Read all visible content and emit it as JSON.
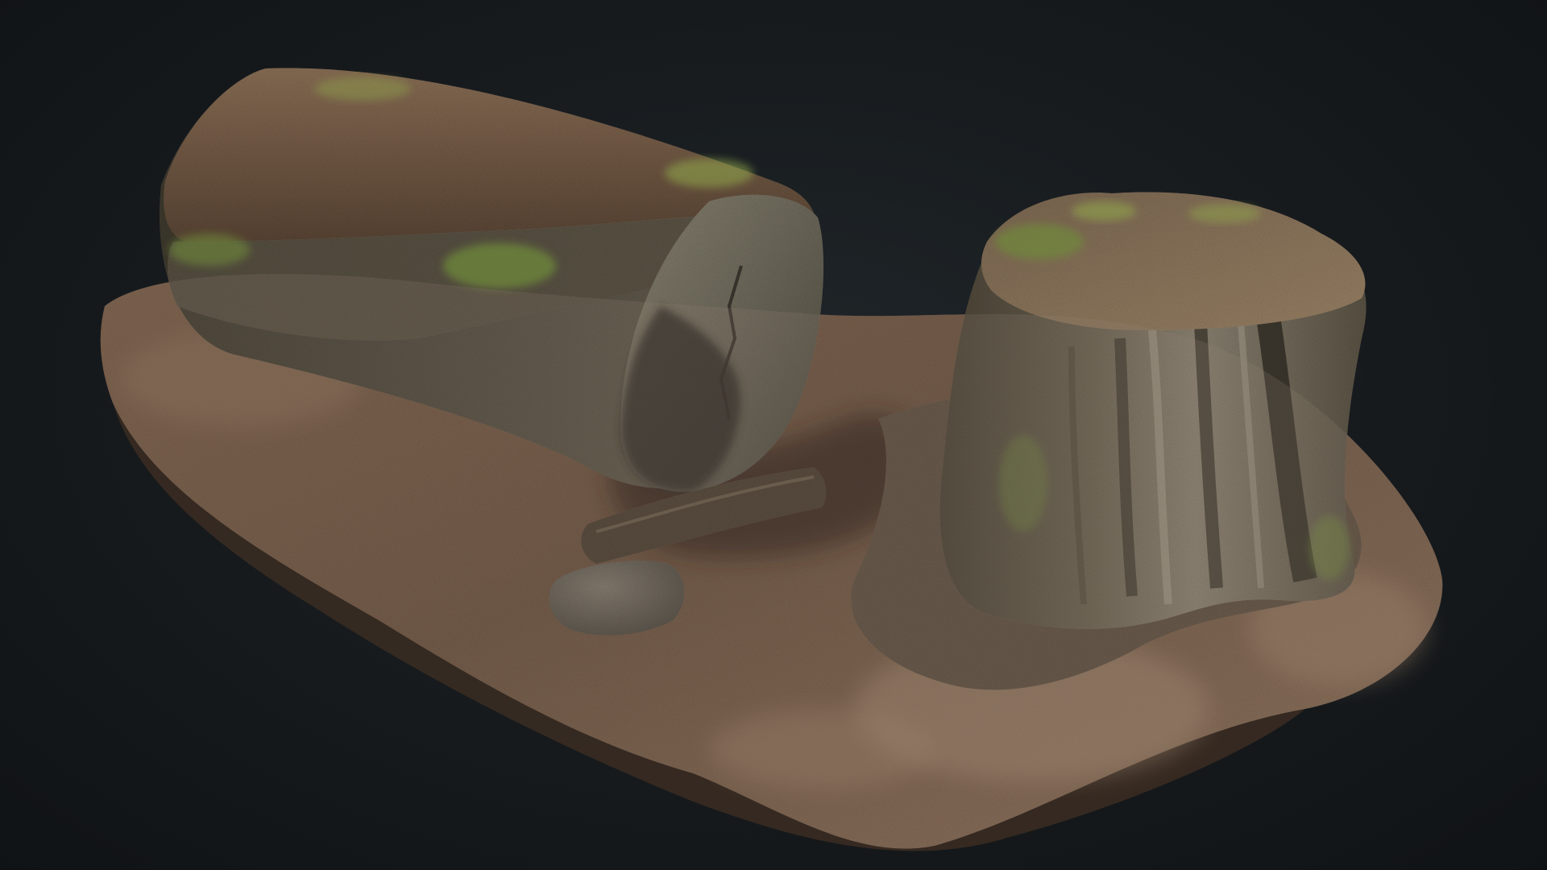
{
  "scene": {
    "subject": "photogrammetry-forest-log-and-stump",
    "background_color": "#15191c",
    "palette": {
      "soil_dark": "#3b2d22",
      "soil_mid": "#6a5240",
      "soil_light": "#9a7e66",
      "bark_grey": "#5f5a50",
      "bark_light": "#8c8576",
      "cut_face": "#6d6a5d",
      "moss": "#6f8a3a",
      "moss_light": "#93aa4c",
      "shadow": "#1d1712",
      "stone": "#66625a"
    }
  }
}
